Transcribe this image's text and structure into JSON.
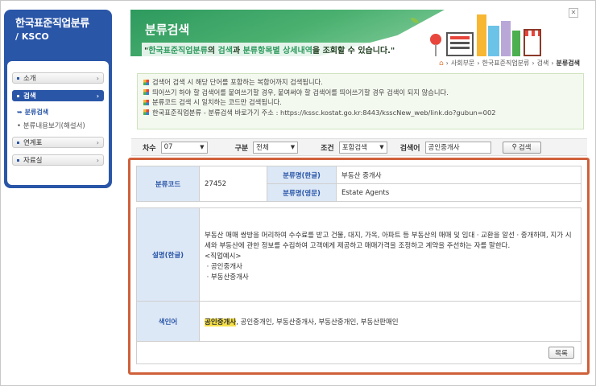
{
  "sidebar": {
    "logo_line1": "한국표준직업분류",
    "logo_line2": "/ KSCO",
    "menu": [
      {
        "label": "소개"
      },
      {
        "label": "검색"
      },
      {
        "label": "연계표"
      },
      {
        "label": "자료실"
      }
    ],
    "sub": [
      {
        "label": "분류검색"
      },
      {
        "label": "분류내용보기(해설서)"
      }
    ]
  },
  "banner": {
    "title": "분류검색",
    "desc_open": "\"",
    "desc_g1": "한국표준직업분류",
    "desc_t1": "의 ",
    "desc_g2": "검색",
    "desc_t2": "과 ",
    "desc_g3": "분류항목별 상세내역",
    "desc_t3": "을 조회할 수 있습니다.\""
  },
  "breadcrumb": [
    "사회부문",
    "한국표준직업분류",
    "검색",
    "분류검색"
  ],
  "info": [
    "검색어 검색 시 해당 단어를 포함하는 복합어까지 검색됩니다.",
    "띄어쓰기 하야 할 검색어를 붙여쓰기할 경우, 붙여써야 할 검색어를 띄어쓰기할 경우 검색이 되지 않습니다.",
    "분류코드 검색 시 일치하는 코드만 검색됩니다.",
    "한국표준직업분류 - 분류검색 바로가기 주소 : https://kssc.kostat.go.kr:8443/ksscNew_web/link.do?gubun=002"
  ],
  "search": {
    "degree_label": "차수",
    "degree_value": "07",
    "type_label": "구분",
    "type_value": "전체",
    "cond_label": "조건",
    "cond_value": "포함검색",
    "kw_label": "검색어",
    "kw_value": "공인중개사",
    "button": "검색"
  },
  "result": {
    "code_label": "분류코드",
    "code_value": "27452",
    "name_ko_label": "분류명(한글)",
    "name_ko_value": "부동산 중개사",
    "name_en_label": "분류명(영문)",
    "name_en_value": "Estate Agents",
    "desc_label": "설명(한글)",
    "desc_text": "부동산 매매 쌍방을 머리하여 수수료를 받고 건물, 대지, 가옥, 아파트 등 부동산의 매매 및 임대ㆍ교환을 알선ㆍ중개하며, 지가 시세와 부동산에 관한 정보를 수집하여 고객에게 제공하고 매매가격을 조정하고 계약을 주선하는 자를 말한다.",
    "example_title": "<직업예시>",
    "examples": [
      "ㆍ공인중개사",
      "ㆍ부동산중개사"
    ],
    "index_label": "색인어",
    "index_highlight": "공인중개사",
    "index_rest": ", 공인중개인, 부동산중개사, 부동산중개인, 부동산판매인",
    "list_button": "목록"
  }
}
